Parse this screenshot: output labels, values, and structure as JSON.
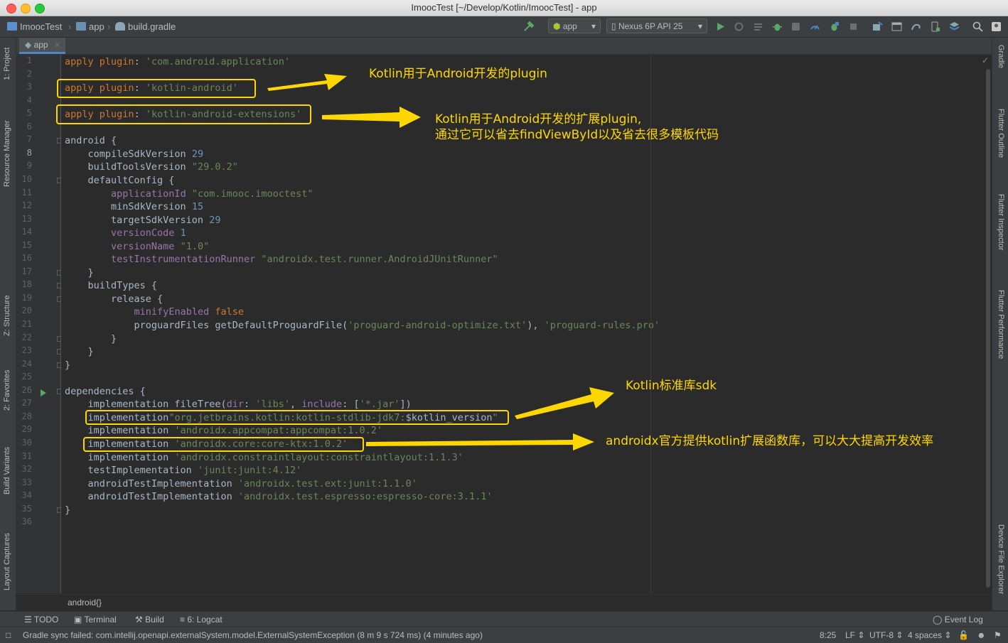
{
  "window": {
    "title": "ImoocTest [~/Develop/Kotlin/ImoocTest] - app"
  },
  "breadcrumbs": [
    "ImoocTest",
    "app",
    "build.gradle"
  ],
  "toolbar": {
    "run_config": "app",
    "device": "Nexus 6P API 25"
  },
  "left_tabs": [
    "1: Project",
    "Resource Manager",
    "Z: Structure",
    "2: Favorites",
    "Build Variants",
    "Layout Captures"
  ],
  "right_tabs": [
    "Gradle",
    "Flutter Outline",
    "Flutter Inspector",
    "Flutter Performance",
    "Device File Explorer"
  ],
  "editor_tab": {
    "label": "app"
  },
  "code_lines": [
    "apply plugin: 'com.android.application'",
    "",
    "apply plugin: 'kotlin-android'",
    "",
    "apply plugin: 'kotlin-android-extensions'",
    "",
    "android {",
    "    compileSdkVersion 29",
    "    buildToolsVersion \"29.0.2\"",
    "    defaultConfig {",
    "        applicationId \"com.imooc.imooctest\"",
    "        minSdkVersion 15",
    "        targetSdkVersion 29",
    "        versionCode 1",
    "        versionName \"1.0\"",
    "        testInstrumentationRunner \"androidx.test.runner.AndroidJUnitRunner\"",
    "    }",
    "    buildTypes {",
    "        release {",
    "            minifyEnabled false",
    "            proguardFiles getDefaultProguardFile('proguard-android-optimize.txt'), 'proguard-rules.pro'",
    "        }",
    "    }",
    "}",
    "",
    "dependencies {",
    "    implementation fileTree(dir: 'libs', include: ['*.jar'])",
    "    implementation\"org.jetbrains.kotlin:kotlin-stdlib-jdk7:$kotlin_version\"",
    "    implementation 'androidx.appcompat:appcompat:1.0.2'",
    "    implementation 'androidx.core:core-ktx:1.0.2'",
    "    implementation 'androidx.constraintlayout:constraintlayout:1.1.3'",
    "    testImplementation 'junit:junit:4.12'",
    "    androidTestImplementation 'androidx.test.ext:junit:1.1.0'",
    "    androidTestImplementation 'androidx.test.espresso:espresso-core:3.1.1'",
    "}",
    ""
  ],
  "annotations": {
    "kotlin_android": "Kotlin用于Android开发的plugin",
    "extensions_line1": "Kotlin用于Android开发的扩展plugin,",
    "extensions_line2": "通过它可以省去findViewById以及省去很多模板代码",
    "stdlib": "Kotlin标准库sdk",
    "core_ktx": "androidx官方提供kotlin扩展函数库，可以大大提高开发效率"
  },
  "editor_breadcrumb": "android{}",
  "tool_windows": [
    "TODO",
    "Terminal",
    "Build",
    "6: Logcat",
    "Event Log"
  ],
  "status": {
    "message": "Gradle sync failed: com.intellij.openapi.externalSystem.model.ExternalSystemException (8 m 9 s 724 ms) (4 minutes ago)",
    "position": "8:25",
    "line_sep": "LF",
    "encoding": "UTF-8",
    "indent": "4 spaces"
  },
  "colors": {
    "annotation": "#ffd700",
    "editor_bg": "#2b2b2b",
    "keyword": "#cc7832",
    "string": "#6a8759",
    "number": "#6897bb",
    "property": "#9876aa"
  }
}
